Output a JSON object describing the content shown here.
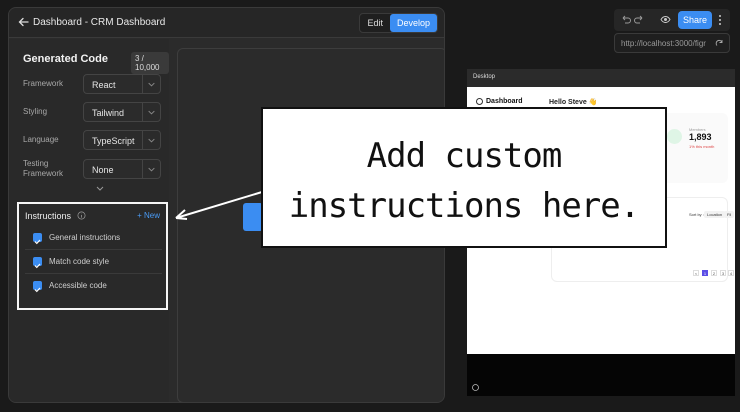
{
  "window": {
    "title": "Dashboard - CRM Dashboard",
    "tabs": [
      "Edit",
      "Develop"
    ],
    "active_tab": "Develop"
  },
  "generated_code": {
    "title": "Generated Code",
    "counter": "3 / 10,000"
  },
  "settings": [
    {
      "label": "Framework",
      "value": "React"
    },
    {
      "label": "Styling",
      "value": "Tailwind"
    },
    {
      "label": "Language",
      "value": "TypeScript"
    },
    {
      "label": "Testing Framework",
      "value": "None"
    }
  ],
  "instructions": {
    "title": "Instructions",
    "new_label": "+ New",
    "items": [
      {
        "label": "General instructions",
        "checked": true
      },
      {
        "label": "Match code style",
        "checked": true
      },
      {
        "label": "Accessible code",
        "checked": true
      }
    ]
  },
  "browser": {
    "share_label": "Share",
    "url": "http://localhost:3000/figr",
    "preview_label": "Desktop"
  },
  "preview": {
    "brand": "Dashboard",
    "greeting": "Hello Steve 👋",
    "stat_value": "1,893",
    "stat_caption": "Members",
    "stat_delta": "1% this month",
    "chips": [
      "Sort by :",
      "Location",
      "Fil"
    ],
    "pages": [
      "<",
      "1",
      "2",
      "3",
      "4",
      ">"
    ]
  },
  "callout": {
    "line1": "Add custom",
    "line2": "instructions here."
  },
  "colors": {
    "accent": "#3b8df2",
    "panel": "#2b2b2b",
    "background": "#1a1a1a"
  }
}
